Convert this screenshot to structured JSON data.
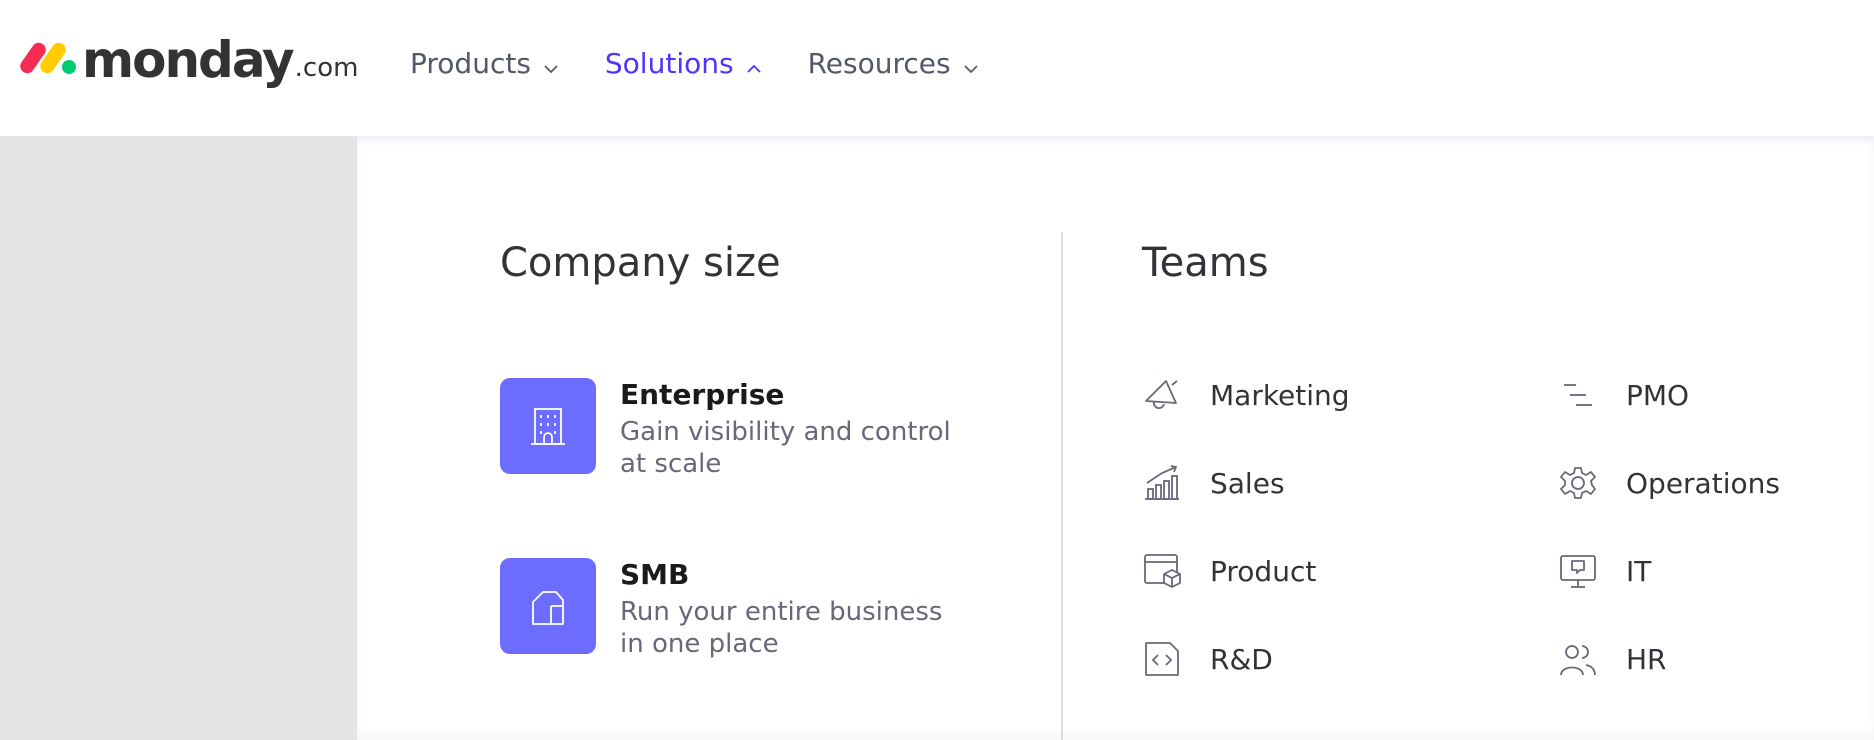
{
  "header": {
    "logo": {
      "word": "monday",
      "suffix": ".com"
    },
    "nav": [
      {
        "label": "Products",
        "active": false
      },
      {
        "label": "Solutions",
        "active": true
      },
      {
        "label": "Resources",
        "active": false
      }
    ]
  },
  "dropdown": {
    "company_size": {
      "title": "Company size",
      "items": [
        {
          "title": "Enterprise",
          "description": "Gain visibility and control at scale",
          "icon": "building-icon"
        },
        {
          "title": "SMB",
          "description": "Run your entire business in one place",
          "icon": "house-icon"
        }
      ]
    },
    "teams": {
      "title": "Teams",
      "items": [
        {
          "label": "Marketing",
          "icon": "megaphone-icon"
        },
        {
          "label": "Sales",
          "icon": "growth-chart-icon"
        },
        {
          "label": "Product",
          "icon": "product-box-icon"
        },
        {
          "label": "R&D",
          "icon": "code-file-icon"
        },
        {
          "label": "PMO",
          "icon": "lines-icon"
        },
        {
          "label": "Operations",
          "icon": "gear-icon"
        },
        {
          "label": "IT",
          "icon": "monitor-icon"
        },
        {
          "label": "HR",
          "icon": "people-icon"
        }
      ]
    }
  },
  "colors": {
    "accent": "#5034ff",
    "card_icon_bg": "#6c6cff",
    "nav_text": "#535768",
    "muted_text": "#676879",
    "side_gray": "#e4e4e4"
  }
}
